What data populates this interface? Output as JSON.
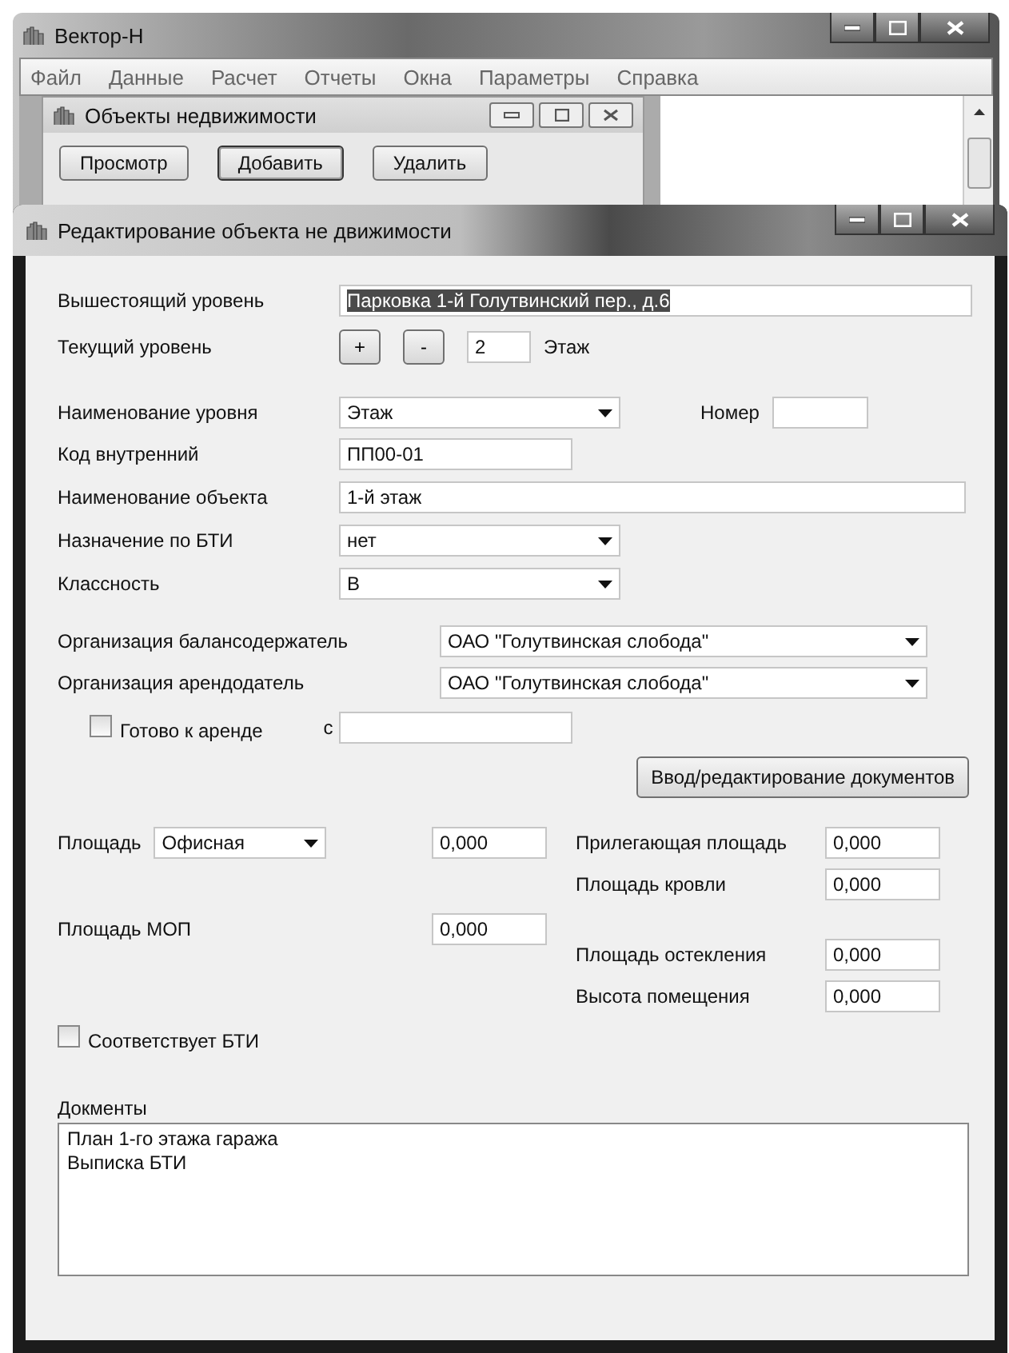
{
  "main_window": {
    "title": "Вектор-Н",
    "menu": [
      "Файл",
      "Данные",
      "Расчет",
      "Отчеты",
      "Окна",
      "Параметры",
      "Справка"
    ]
  },
  "child_window": {
    "title": "Объекты недвижимости",
    "buttons": [
      {
        "label": "Просмотр",
        "focused": false
      },
      {
        "label": "Добавить",
        "focused": true
      },
      {
        "label": "Удалить",
        "focused": false
      }
    ]
  },
  "dialog": {
    "title": "Редактирование объекта не движимости",
    "parent_level": {
      "label": "Вышестоящий уровень",
      "value": "Парковка 1-й Голутвинский пер., д.6",
      "text_selected": true
    },
    "current_level": {
      "label": "Текущий уровень",
      "plus": "+",
      "minus": "-",
      "value": "2",
      "unit": "Этаж"
    },
    "level_name": {
      "label": "Наименование уровня",
      "value": "Этаж"
    },
    "number": {
      "label": "Номер"
    },
    "internal_code": {
      "label": "Код внутренний",
      "value": "ПП00-01"
    },
    "object_name": {
      "label": "Наименование объекта",
      "value": "1-й этаж"
    },
    "bti_purpose": {
      "label": "Назначение по БТИ",
      "value": "нет"
    },
    "class": {
      "label": "Классность",
      "value": "В"
    },
    "balance_holder": {
      "label": "Организация балансодержатель",
      "value": "ОАО \"Голутвинская слобода\""
    },
    "lessor": {
      "label": "Организация арендодатель",
      "value": "ОАО \"Голутвинская слобода\""
    },
    "ready_for_rent": {
      "label": "Готово к аренде",
      "checked": false,
      "from_label": "с"
    },
    "documents_button": "Ввод/редактирование документов",
    "area": {
      "label": "Площадь",
      "type": "Офисная",
      "value": "0,000"
    },
    "mop_area": {
      "label": "Площадь МОП",
      "value": "0,000"
    },
    "right_areas": [
      {
        "label": "Прилегающая площадь",
        "value": "0,000"
      },
      {
        "label": "Площадь кровли",
        "value": "0,000"
      },
      {
        "label": "Площадь остекления",
        "value": "0,000"
      },
      {
        "label": "Высота помещения",
        "value": "0,000"
      }
    ],
    "bti_match": {
      "label": "Соответствует БТИ",
      "checked": false
    },
    "documents": {
      "label": "Докменты",
      "items": [
        "План 1-го этажа гаража",
        "Выписка БТИ"
      ]
    }
  }
}
